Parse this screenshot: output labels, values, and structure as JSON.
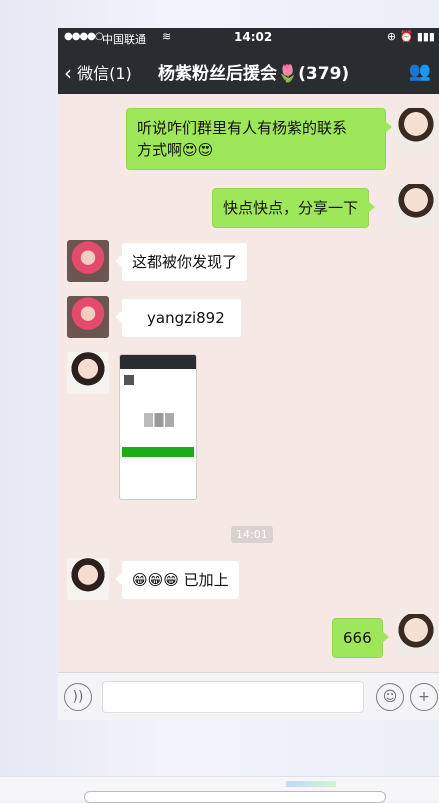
{
  "status": {
    "signal": "●●●●○",
    "carrier": "中国联通",
    "wifi": "≋",
    "time": "14:02",
    "icons": "⊕ ⏰ ▮▮▮"
  },
  "nav": {
    "back_label": "微信(1)",
    "title": "杨紫粉丝后援会🌷(379)"
  },
  "messages": [
    {
      "side": "me",
      "text_line1": "听说咋们群里有人有杨紫的联系",
      "text_line2": "方式啊😍😍"
    },
    {
      "side": "me",
      "text": "快点快点，分享一下"
    },
    {
      "side": "other",
      "text": "这都被你发现了"
    },
    {
      "side": "other",
      "text": "yangzi892"
    },
    {
      "side": "other",
      "kind": "image"
    },
    {
      "side": "other",
      "text": "😁😁😁 已加上"
    },
    {
      "side": "me",
      "text": "666"
    }
  ],
  "timestamp": "14:01",
  "input": {
    "voice_icon": "voice-icon",
    "emoji_icon": "emoji-icon",
    "plus_icon": "plus-icon"
  },
  "colors": {
    "bg": "#f6e9e5",
    "me_bubble": "#9fe75a",
    "navbar": "#2a2d30"
  }
}
